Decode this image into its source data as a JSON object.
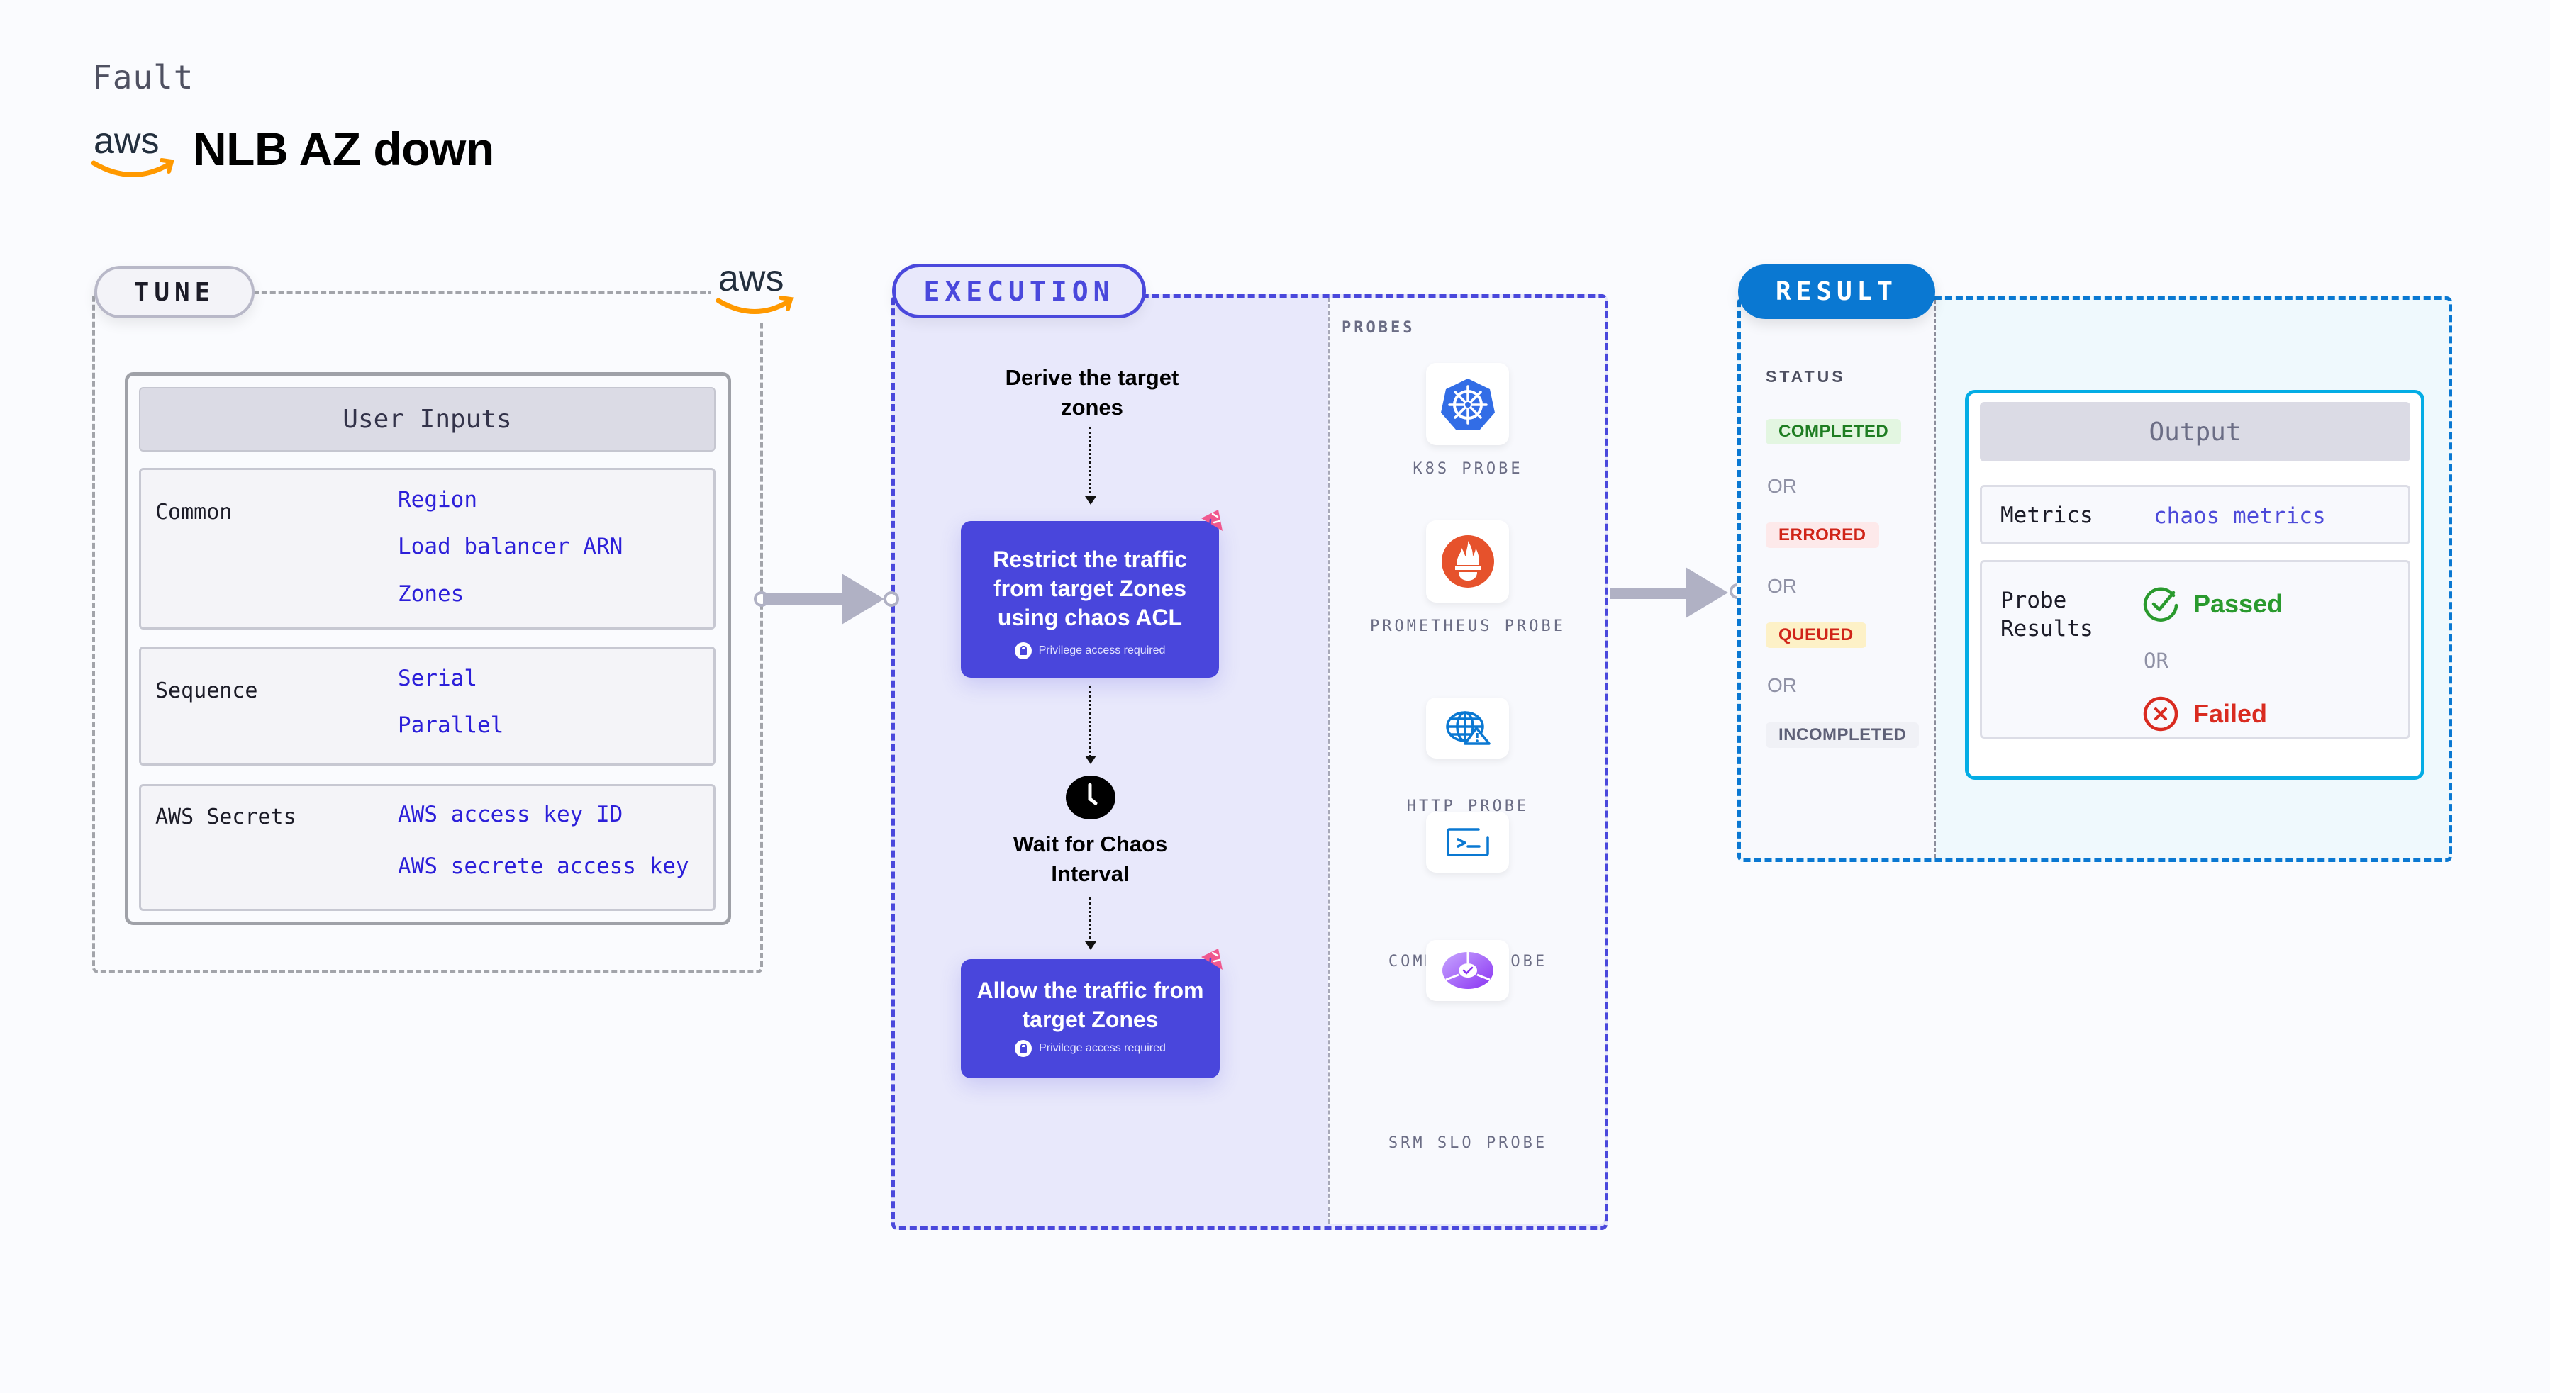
{
  "header": {
    "eyebrow": "Fault",
    "title": "NLB AZ down",
    "provider_icon": "aws-logo"
  },
  "tune": {
    "pill_label": "TUNE",
    "provider_icon": "aws-logo",
    "panel_title": "User Inputs",
    "groups": [
      {
        "label": "Common",
        "items": [
          "Region",
          "Load balancer ARN",
          "Zones"
        ]
      },
      {
        "label": "Sequence",
        "items": [
          "Serial",
          "Parallel"
        ]
      },
      {
        "label": "AWS Secrets",
        "items": [
          "AWS access key ID",
          "AWS secrete access key"
        ]
      }
    ]
  },
  "execution": {
    "pill_label": "EXECUTION",
    "steps": [
      {
        "type": "text",
        "label": "Derive the target zones"
      },
      {
        "type": "action",
        "label": "Restrict the traffic from target Zones using chaos ACL",
        "note": "Privilege access required",
        "icon": "chaos-badge"
      },
      {
        "type": "wait",
        "label": "Wait for Chaos Interval",
        "icon": "clock-icon"
      },
      {
        "type": "action",
        "label": "Allow the traffic from target Zones",
        "note": "Privilege access required",
        "icon": "chaos-badge"
      }
    ],
    "probes_title": "PROBES",
    "probes": [
      {
        "label": "K8S PROBE",
        "icon": "kubernetes-icon"
      },
      {
        "label": "PROMETHEUS PROBE",
        "icon": "prometheus-icon"
      },
      {
        "label": "HTTP PROBE",
        "icon": "globe-warning-icon"
      },
      {
        "label": "COMMAND PROBE",
        "icon": "terminal-icon"
      },
      {
        "label": "SRM SLO PROBE",
        "icon": "slo-icon"
      }
    ]
  },
  "result": {
    "pill_label": "RESULT",
    "status_title": "STATUS",
    "or_label": "OR",
    "statuses": [
      {
        "label": "COMPLETED",
        "color": "#1e7d22",
        "bg": "#e3f6e1"
      },
      {
        "label": "ERRORED",
        "color": "#d02418",
        "bg": "#fde9ea"
      },
      {
        "label": "QUEUED",
        "color": "#d02418",
        "bg": "#fdf1c7"
      },
      {
        "label": "INCOMPLETED",
        "color": "#5e6077",
        "bg": "#f0f1f6"
      }
    ],
    "output": {
      "title": "Output",
      "metrics_label": "Metrics",
      "metrics_value": "chaos metrics",
      "probe_results_label": "Probe Results",
      "or_label": "OR",
      "passed": {
        "label": "Passed",
        "color": "#2a9a2e"
      },
      "failed": {
        "label": "Failed",
        "color": "#d92b20"
      }
    }
  },
  "colors": {
    "execution_accent": "#4a48dc",
    "result_accent": "#0a78d2",
    "output_border": "#04ade5",
    "input_value": "#2c1fd9"
  }
}
